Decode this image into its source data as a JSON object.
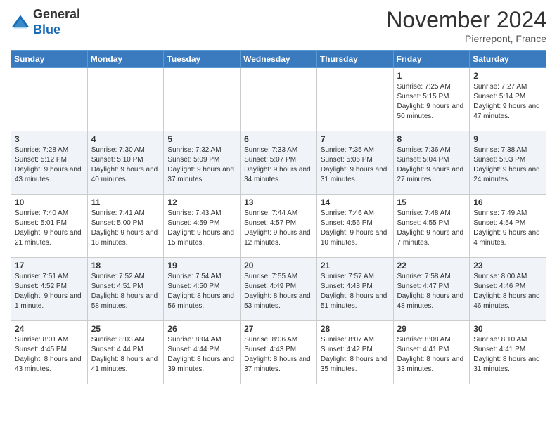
{
  "header": {
    "title": "November 2024",
    "location": "Pierrepont, France",
    "logo_general": "General",
    "logo_blue": "Blue"
  },
  "days_of_week": [
    "Sunday",
    "Monday",
    "Tuesday",
    "Wednesday",
    "Thursday",
    "Friday",
    "Saturday"
  ],
  "weeks": [
    [
      {
        "day": "",
        "info": ""
      },
      {
        "day": "",
        "info": ""
      },
      {
        "day": "",
        "info": ""
      },
      {
        "day": "",
        "info": ""
      },
      {
        "day": "",
        "info": ""
      },
      {
        "day": "1",
        "info": "Sunrise: 7:25 AM\nSunset: 5:15 PM\nDaylight: 9 hours and 50 minutes."
      },
      {
        "day": "2",
        "info": "Sunrise: 7:27 AM\nSunset: 5:14 PM\nDaylight: 9 hours and 47 minutes."
      }
    ],
    [
      {
        "day": "3",
        "info": "Sunrise: 7:28 AM\nSunset: 5:12 PM\nDaylight: 9 hours and 43 minutes."
      },
      {
        "day": "4",
        "info": "Sunrise: 7:30 AM\nSunset: 5:10 PM\nDaylight: 9 hours and 40 minutes."
      },
      {
        "day": "5",
        "info": "Sunrise: 7:32 AM\nSunset: 5:09 PM\nDaylight: 9 hours and 37 minutes."
      },
      {
        "day": "6",
        "info": "Sunrise: 7:33 AM\nSunset: 5:07 PM\nDaylight: 9 hours and 34 minutes."
      },
      {
        "day": "7",
        "info": "Sunrise: 7:35 AM\nSunset: 5:06 PM\nDaylight: 9 hours and 31 minutes."
      },
      {
        "day": "8",
        "info": "Sunrise: 7:36 AM\nSunset: 5:04 PM\nDaylight: 9 hours and 27 minutes."
      },
      {
        "day": "9",
        "info": "Sunrise: 7:38 AM\nSunset: 5:03 PM\nDaylight: 9 hours and 24 minutes."
      }
    ],
    [
      {
        "day": "10",
        "info": "Sunrise: 7:40 AM\nSunset: 5:01 PM\nDaylight: 9 hours and 21 minutes."
      },
      {
        "day": "11",
        "info": "Sunrise: 7:41 AM\nSunset: 5:00 PM\nDaylight: 9 hours and 18 minutes."
      },
      {
        "day": "12",
        "info": "Sunrise: 7:43 AM\nSunset: 4:59 PM\nDaylight: 9 hours and 15 minutes."
      },
      {
        "day": "13",
        "info": "Sunrise: 7:44 AM\nSunset: 4:57 PM\nDaylight: 9 hours and 12 minutes."
      },
      {
        "day": "14",
        "info": "Sunrise: 7:46 AM\nSunset: 4:56 PM\nDaylight: 9 hours and 10 minutes."
      },
      {
        "day": "15",
        "info": "Sunrise: 7:48 AM\nSunset: 4:55 PM\nDaylight: 9 hours and 7 minutes."
      },
      {
        "day": "16",
        "info": "Sunrise: 7:49 AM\nSunset: 4:54 PM\nDaylight: 9 hours and 4 minutes."
      }
    ],
    [
      {
        "day": "17",
        "info": "Sunrise: 7:51 AM\nSunset: 4:52 PM\nDaylight: 9 hours and 1 minute."
      },
      {
        "day": "18",
        "info": "Sunrise: 7:52 AM\nSunset: 4:51 PM\nDaylight: 8 hours and 58 minutes."
      },
      {
        "day": "19",
        "info": "Sunrise: 7:54 AM\nSunset: 4:50 PM\nDaylight: 8 hours and 56 minutes."
      },
      {
        "day": "20",
        "info": "Sunrise: 7:55 AM\nSunset: 4:49 PM\nDaylight: 8 hours and 53 minutes."
      },
      {
        "day": "21",
        "info": "Sunrise: 7:57 AM\nSunset: 4:48 PM\nDaylight: 8 hours and 51 minutes."
      },
      {
        "day": "22",
        "info": "Sunrise: 7:58 AM\nSunset: 4:47 PM\nDaylight: 8 hours and 48 minutes."
      },
      {
        "day": "23",
        "info": "Sunrise: 8:00 AM\nSunset: 4:46 PM\nDaylight: 8 hours and 46 minutes."
      }
    ],
    [
      {
        "day": "24",
        "info": "Sunrise: 8:01 AM\nSunset: 4:45 PM\nDaylight: 8 hours and 43 minutes."
      },
      {
        "day": "25",
        "info": "Sunrise: 8:03 AM\nSunset: 4:44 PM\nDaylight: 8 hours and 41 minutes."
      },
      {
        "day": "26",
        "info": "Sunrise: 8:04 AM\nSunset: 4:44 PM\nDaylight: 8 hours and 39 minutes."
      },
      {
        "day": "27",
        "info": "Sunrise: 8:06 AM\nSunset: 4:43 PM\nDaylight: 8 hours and 37 minutes."
      },
      {
        "day": "28",
        "info": "Sunrise: 8:07 AM\nSunset: 4:42 PM\nDaylight: 8 hours and 35 minutes."
      },
      {
        "day": "29",
        "info": "Sunrise: 8:08 AM\nSunset: 4:41 PM\nDaylight: 8 hours and 33 minutes."
      },
      {
        "day": "30",
        "info": "Sunrise: 8:10 AM\nSunset: 4:41 PM\nDaylight: 8 hours and 31 minutes."
      }
    ]
  ]
}
